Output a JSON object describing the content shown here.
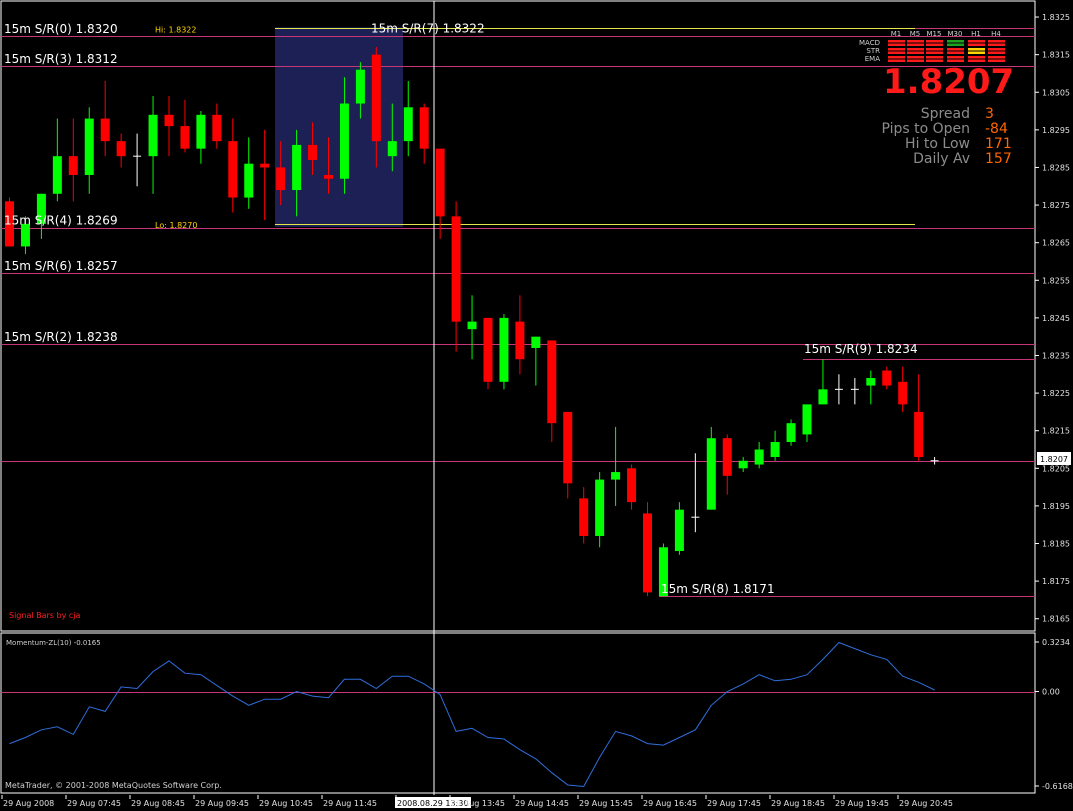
{
  "chart_data": {
    "type": "candlestick",
    "symbol_note": "",
    "price_range": [
      1.8162,
      1.8329
    ],
    "price_ticks": [
      "1.8325",
      "1.8315",
      "1.8305",
      "1.8295",
      "1.8285",
      "1.8275",
      "1.8265",
      "1.8255",
      "1.8245",
      "1.8235",
      "1.8225",
      "1.8215",
      "1.8205",
      "1.8195",
      "1.8185",
      "1.8175",
      "1.8165"
    ],
    "current_price_label": "1.8207",
    "candles": [
      {
        "o": 1.8276,
        "h": 1.8277,
        "l": 1.8264,
        "c": 1.8264
      },
      {
        "o": 1.8264,
        "h": 1.8272,
        "l": 1.8262,
        "c": 1.827
      },
      {
        "o": 1.827,
        "h": 1.8278,
        "l": 1.8266,
        "c": 1.8278
      },
      {
        "o": 1.8278,
        "h": 1.8298,
        "l": 1.8276,
        "c": 1.8288
      },
      {
        "o": 1.8288,
        "h": 1.8298,
        "l": 1.8276,
        "c": 1.8283
      },
      {
        "o": 1.8283,
        "h": 1.8301,
        "l": 1.8278,
        "c": 1.8298
      },
      {
        "o": 1.8298,
        "h": 1.8308,
        "l": 1.8288,
        "c": 1.8292
      },
      {
        "o": 1.8292,
        "h": 1.8294,
        "l": 1.8285,
        "c": 1.8288
      },
      {
        "o": 1.8288,
        "h": 1.8294,
        "l": 1.828,
        "c": 1.8288
      },
      {
        "o": 1.8288,
        "h": 1.8304,
        "l": 1.8278,
        "c": 1.8299
      },
      {
        "o": 1.8299,
        "h": 1.8304,
        "l": 1.8288,
        "c": 1.8296
      },
      {
        "o": 1.8296,
        "h": 1.8303,
        "l": 1.8289,
        "c": 1.829
      },
      {
        "o": 1.829,
        "h": 1.83,
        "l": 1.8286,
        "c": 1.8299
      },
      {
        "o": 1.8299,
        "h": 1.8302,
        "l": 1.829,
        "c": 1.8292
      },
      {
        "o": 1.8292,
        "h": 1.8298,
        "l": 1.8273,
        "c": 1.8277
      },
      {
        "o": 1.8277,
        "h": 1.8293,
        "l": 1.8274,
        "c": 1.8286
      },
      {
        "o": 1.8286,
        "h": 1.8295,
        "l": 1.8271,
        "c": 1.8285
      },
      {
        "o": 1.8285,
        "h": 1.8292,
        "l": 1.8275,
        "c": 1.8279
      },
      {
        "o": 1.8279,
        "h": 1.8295,
        "l": 1.8272,
        "c": 1.8291
      },
      {
        "o": 1.8291,
        "h": 1.8297,
        "l": 1.8283,
        "c": 1.8287
      },
      {
        "o": 1.8283,
        "h": 1.8293,
        "l": 1.8278,
        "c": 1.8282
      },
      {
        "o": 1.8282,
        "h": 1.8309,
        "l": 1.8278,
        "c": 1.8302
      },
      {
        "o": 1.8302,
        "h": 1.8313,
        "l": 1.8298,
        "c": 1.8311
      },
      {
        "o": 1.8315,
        "h": 1.8317,
        "l": 1.8285,
        "c": 1.8292
      },
      {
        "o": 1.8288,
        "h": 1.8302,
        "l": 1.8284,
        "c": 1.8292
      },
      {
        "o": 1.8292,
        "h": 1.8308,
        "l": 1.8288,
        "c": 1.8301
      },
      {
        "o": 1.8301,
        "h": 1.8302,
        "l": 1.8286,
        "c": 1.829
      },
      {
        "o": 1.829,
        "h": 1.829,
        "l": 1.8266,
        "c": 1.8272
      },
      {
        "o": 1.8272,
        "h": 1.8276,
        "l": 1.8236,
        "c": 1.8244
      },
      {
        "o": 1.8242,
        "h": 1.8251,
        "l": 1.8234,
        "c": 1.8244
      },
      {
        "o": 1.8245,
        "h": 1.8245,
        "l": 1.8226,
        "c": 1.8228
      },
      {
        "o": 1.8228,
        "h": 1.8246,
        "l": 1.8226,
        "c": 1.8245
      },
      {
        "o": 1.8244,
        "h": 1.8251,
        "l": 1.823,
        "c": 1.8234
      },
      {
        "o": 1.8237,
        "h": 1.824,
        "l": 1.8227,
        "c": 1.824
      },
      {
        "o": 1.8239,
        "h": 1.8239,
        "l": 1.8212,
        "c": 1.8217
      },
      {
        "o": 1.822,
        "h": 1.822,
        "l": 1.8197,
        "c": 1.8201
      },
      {
        "o": 1.8197,
        "h": 1.82,
        "l": 1.8185,
        "c": 1.8187
      },
      {
        "o": 1.8187,
        "h": 1.8204,
        "l": 1.8184,
        "c": 1.8202
      },
      {
        "o": 1.8202,
        "h": 1.8216,
        "l": 1.8195,
        "c": 1.8204
      },
      {
        "o": 1.8205,
        "h": 1.8206,
        "l": 1.8194,
        "c": 1.8196
      },
      {
        "o": 1.8193,
        "h": 1.8196,
        "l": 1.8171,
        "c": 1.8172
      },
      {
        "o": 1.8171,
        "h": 1.8185,
        "l": 1.8171,
        "c": 1.8184
      },
      {
        "o": 1.8183,
        "h": 1.8196,
        "l": 1.8182,
        "c": 1.8194
      },
      {
        "o": 1.8192,
        "h": 1.8209,
        "l": 1.8188,
        "c": 1.8192
      },
      {
        "o": 1.8194,
        "h": 1.8216,
        "l": 1.8194,
        "c": 1.8213
      },
      {
        "o": 1.8213,
        "h": 1.8214,
        "l": 1.8198,
        "c": 1.8203
      },
      {
        "o": 1.8205,
        "h": 1.8208,
        "l": 1.8204,
        "c": 1.8207
      },
      {
        "o": 1.8206,
        "h": 1.8212,
        "l": 1.8205,
        "c": 1.821
      },
      {
        "o": 1.8208,
        "h": 1.8215,
        "l": 1.8207,
        "c": 1.8212
      },
      {
        "o": 1.8212,
        "h": 1.8218,
        "l": 1.8211,
        "c": 1.8217
      },
      {
        "o": 1.8214,
        "h": 1.8222,
        "l": 1.8212,
        "c": 1.8222
      },
      {
        "o": 1.8222,
        "h": 1.8234,
        "l": 1.8222,
        "c": 1.8226
      },
      {
        "o": 1.8226,
        "h": 1.823,
        "l": 1.8222,
        "c": 1.8226
      },
      {
        "o": 1.8226,
        "h": 1.8229,
        "l": 1.8222,
        "c": 1.8226
      },
      {
        "o": 1.8227,
        "h": 1.8231,
        "l": 1.8222,
        "c": 1.8229
      },
      {
        "o": 1.8231,
        "h": 1.8232,
        "l": 1.8226,
        "c": 1.8227
      },
      {
        "o": 1.8228,
        "h": 1.8232,
        "l": 1.822,
        "c": 1.8222
      },
      {
        "o": 1.822,
        "h": 1.823,
        "l": 1.8207,
        "c": 1.8208
      },
      {
        "o": 1.8207,
        "h": 1.8208,
        "l": 1.8206,
        "c": 1.8207
      }
    ],
    "support_resistance": [
      {
        "label": "15m S/R(0) 1.8320",
        "price": 1.832,
        "color": "#c8367a",
        "label_side": "left"
      },
      {
        "label": "15m S/R(3) 1.8312",
        "price": 1.8312,
        "color": "#c8367a",
        "label_side": "left"
      },
      {
        "label": "15m S/R(4) 1.8269",
        "price": 1.8269,
        "color": "#c8367a",
        "label_side": "left"
      },
      {
        "label": "15m S/R(6) 1.8257",
        "price": 1.8257,
        "color": "#c8367a",
        "label_side": "left"
      },
      {
        "label": "15m S/R(2) 1.8238",
        "price": 1.8238,
        "color": "#c8367a",
        "label_side": "left"
      },
      {
        "label": "15m S/R(7) 1.8322",
        "price": 1.8322,
        "color": "#c8367a",
        "label_side": "top"
      },
      {
        "label": "15m S/R(9) 1.8234",
        "price": 1.8234,
        "color": "#c8367a",
        "label_side": "right"
      },
      {
        "label": "15m S/R(8) 1.8171",
        "price": 1.8171,
        "color": "#c8367a",
        "label_side": "bottom"
      }
    ],
    "hi_line": {
      "label": "Hi: 1.8322",
      "price": 1.8322,
      "color": "#e6e64a"
    },
    "lo_line": {
      "label": "Lo: 1.8270",
      "price": 1.827,
      "color": "#e6e64a"
    },
    "current_price_line": {
      "price": 1.8207,
      "color": "#c8367a"
    },
    "time_labels": [
      "29 Aug 2008",
      "29 Aug 07:45",
      "29 Aug 08:45",
      "29 Aug 09:45",
      "29 Aug 10:45",
      "29 Aug 11:45",
      "2008.08.29 13:30",
      "29 Aug 13:45",
      "29 Aug 14:45",
      "29 Aug 15:45",
      "29 Aug 16:45",
      "29 Aug 17:45",
      "29 Aug 18:45",
      "29 Aug 19:45",
      "29 Aug 20:45"
    ],
    "momentum": {
      "title": "Momentum-ZL(10) -0.0165",
      "ticks": [
        "0.3234",
        "0.00",
        "-0.6168"
      ],
      "range": [
        -0.6168,
        0.3234
      ],
      "values": [
        -0.34,
        -0.3,
        -0.25,
        -0.23,
        -0.28,
        -0.1,
        -0.13,
        0.03,
        0.02,
        0.13,
        0.2,
        0.12,
        0.11,
        0.04,
        -0.03,
        -0.09,
        -0.05,
        -0.05,
        0.0,
        -0.03,
        -0.04,
        0.08,
        0.08,
        0.02,
        0.1,
        0.1,
        0.05,
        -0.02,
        -0.26,
        -0.24,
        -0.3,
        -0.31,
        -0.38,
        -0.44,
        -0.53,
        -0.61,
        -0.62,
        -0.43,
        -0.26,
        -0.29,
        -0.34,
        -0.35,
        -0.3,
        -0.25,
        -0.09,
        0.0,
        0.05,
        0.11,
        0.07,
        0.08,
        0.11,
        0.21,
        0.32,
        0.28,
        0.24,
        0.21,
        0.1,
        0.06,
        0.01
      ]
    }
  },
  "info_panel": {
    "timeframes": [
      "M1",
      "M5",
      "M15",
      "M30",
      "H1",
      "H4"
    ],
    "indicators": [
      "MACD",
      "STR",
      "EMA"
    ],
    "matrix_colors": [
      [
        "#ff1a1a",
        "#ff1a1a",
        "#ff1a1a",
        "#1fa01f",
        "#ff1a1a",
        "#ff1a1a"
      ],
      [
        "#ff1a1a",
        "#ff1a1a",
        "#ff1a1a",
        "#ff1a1a",
        "#ffd400",
        "#ff1a1a"
      ],
      [
        "#ff1a1a",
        "#ff1a1a",
        "#ff1a1a",
        "#ff1a1a",
        "#ff1a1a",
        "#ff1a1a"
      ]
    ],
    "price": "1.8207",
    "rows": [
      {
        "key": "Spread",
        "value": "3"
      },
      {
        "key": "Pips to Open",
        "value": "-84"
      },
      {
        "key": "Hi to Low",
        "value": "171"
      },
      {
        "key": "Daily Av",
        "value": "157"
      }
    ]
  },
  "signature": "Signal Bars by cja",
  "footer": "MetaTrader, © 2001-2008 MetaQuotes Software Corp.",
  "colors": {
    "bull": "#00ff00",
    "bear": "#ff0000",
    "doji": "#ffffff",
    "grid": "#ffffff",
    "momentum_line": "#2f6fdc",
    "session_box": "#1c2055"
  }
}
